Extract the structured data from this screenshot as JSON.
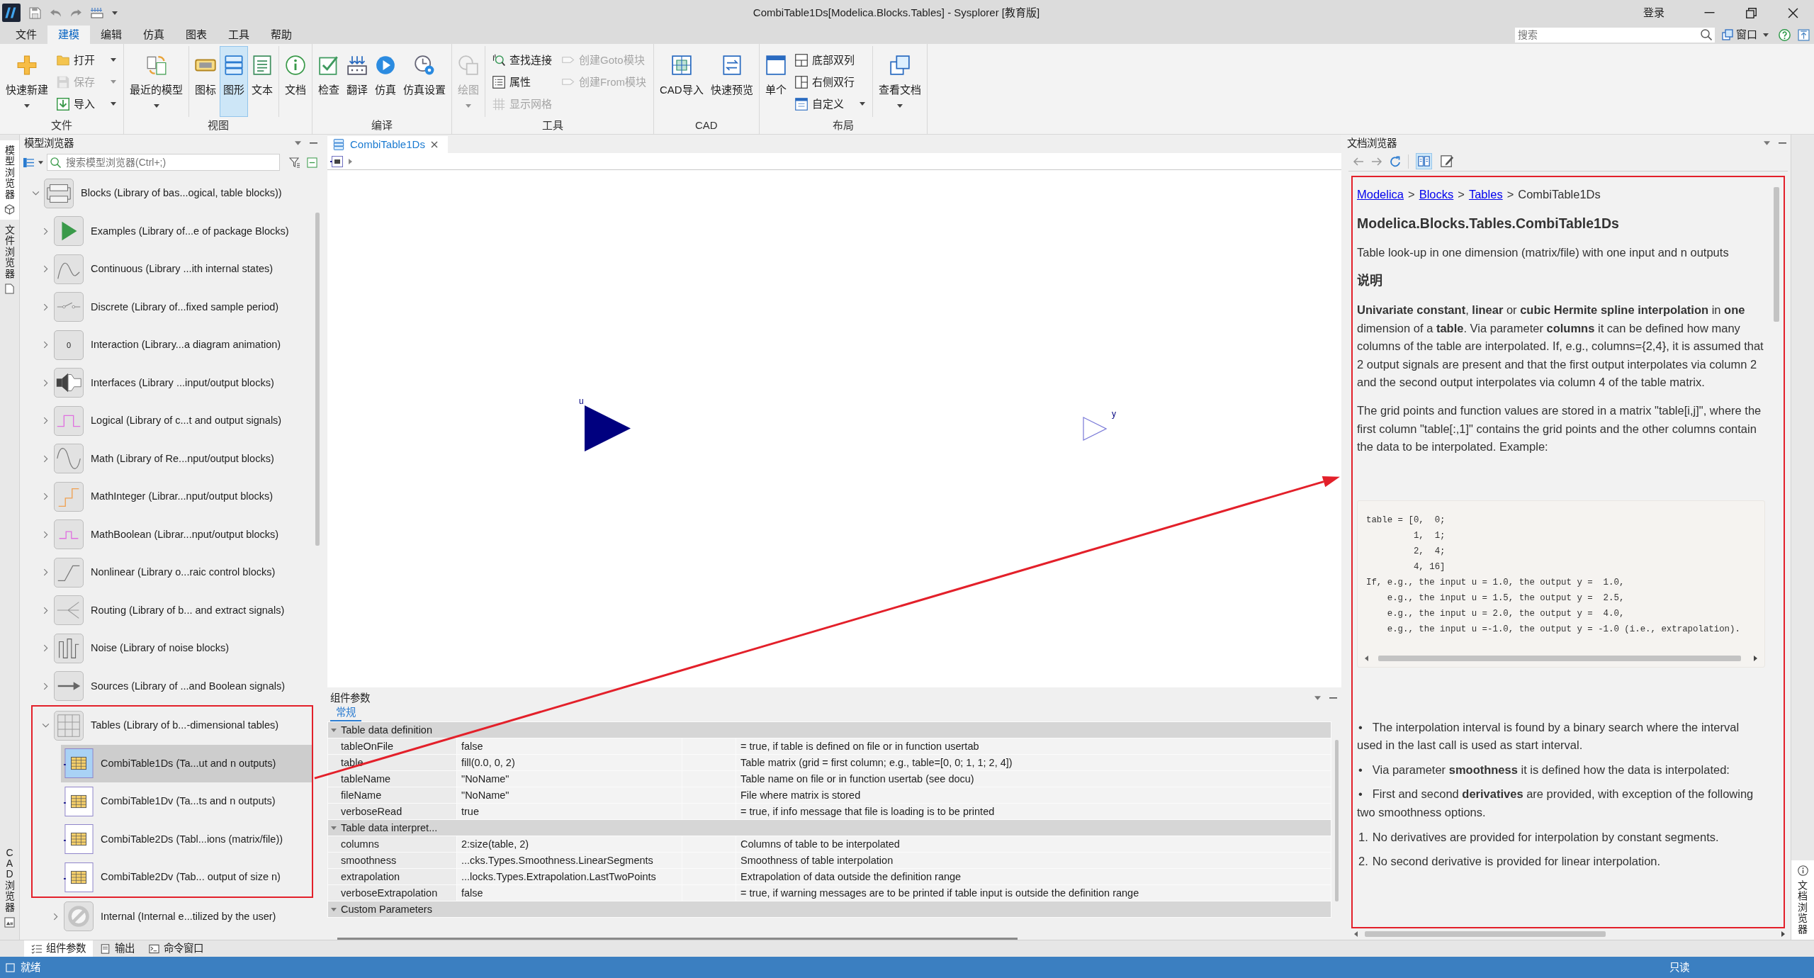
{
  "window": {
    "title": "CombiTable1Ds[Modelica.Blocks.Tables] - Sysplorer [教育版]",
    "login": "登录"
  },
  "menu": [
    {
      "label": "文件",
      "selected": false
    },
    {
      "label": "建模",
      "selected": true
    },
    {
      "label": "编辑",
      "selected": false
    },
    {
      "label": "仿真",
      "selected": false
    },
    {
      "label": "图表",
      "selected": false
    },
    {
      "label": "工具",
      "selected": false
    },
    {
      "label": "帮助",
      "selected": false
    }
  ],
  "search": {
    "placeholder": "搜索"
  },
  "window_menu": {
    "label": "窗口"
  },
  "ribbon": [
    {
      "label": "文件",
      "sections": [
        [
          {
            "label": "快速新建",
            "kind": "large",
            "dropdown": true,
            "disabled": false,
            "selected": false
          },
          {
            "label": "打开",
            "kind": "small",
            "dropdown": true,
            "disabled": false,
            "selected": false
          },
          {
            "label": "保存",
            "kind": "small",
            "dropdown": true,
            "disabled": true,
            "selected": false
          },
          {
            "label": "导入",
            "kind": "small",
            "dropdown": true,
            "disabled": false,
            "selected": false
          }
        ]
      ]
    },
    {
      "label": "视图",
      "sections": [
        [
          {
            "label": "最近的模型",
            "kind": "large",
            "dropdown": true,
            "disabled": false,
            "selected": false
          }
        ],
        [
          {
            "label": "图标",
            "kind": "large",
            "dropdown": false,
            "disabled": false,
            "selected": false
          },
          {
            "label": "图形",
            "kind": "large",
            "dropdown": false,
            "disabled": false,
            "selected": true
          },
          {
            "label": "文本",
            "kind": "large",
            "dropdown": false,
            "disabled": false,
            "selected": false
          }
        ],
        [
          {
            "label": "文档",
            "kind": "large",
            "dropdown": false,
            "disabled": false,
            "selected": false
          }
        ]
      ]
    },
    {
      "label": "编译",
      "sections": [
        [
          {
            "label": "检查",
            "kind": "large",
            "dropdown": false,
            "disabled": false,
            "selected": false
          },
          {
            "label": "翻译",
            "kind": "large",
            "dropdown": false,
            "disabled": false,
            "selected": false
          },
          {
            "label": "仿真",
            "kind": "large",
            "dropdown": false,
            "disabled": false,
            "selected": false
          },
          {
            "label": "仿真设置",
            "kind": "large",
            "dropdown": false,
            "disabled": false,
            "selected": false
          }
        ]
      ]
    },
    {
      "label": "工具",
      "sections": [
        [
          {
            "label": "绘图",
            "kind": "large",
            "dropdown": true,
            "disabled": true,
            "selected": false
          }
        ],
        [
          {
            "label": "查找连接",
            "kind": "small",
            "dropdown": false,
            "disabled": false,
            "selected": false
          },
          {
            "label": "属性",
            "kind": "small",
            "dropdown": false,
            "disabled": false,
            "selected": false
          },
          {
            "label": "显示网格",
            "kind": "small",
            "dropdown": false,
            "disabled": true,
            "selected": false
          },
          {
            "label": "创建Goto模块",
            "kind": "small",
            "dropdown": false,
            "disabled": true,
            "selected": false
          },
          {
            "label": "创建From模块",
            "kind": "small",
            "dropdown": false,
            "disabled": true,
            "selected": false
          }
        ]
      ]
    },
    {
      "label": "CAD",
      "sections": [
        [
          {
            "label": "CAD导入",
            "kind": "large",
            "dropdown": false,
            "disabled": false,
            "selected": false
          },
          {
            "label": "快速预览",
            "kind": "large",
            "dropdown": false,
            "disabled": false,
            "selected": false
          }
        ]
      ]
    },
    {
      "label": "布局",
      "sections": [
        [
          {
            "label": "单个",
            "kind": "large",
            "dropdown": false,
            "disabled": false,
            "selected": false
          },
          {
            "label": "底部双列",
            "kind": "small",
            "dropdown": false,
            "disabled": false,
            "selected": false
          },
          {
            "label": "右侧双行",
            "kind": "small",
            "dropdown": false,
            "disabled": false,
            "selected": false
          },
          {
            "label": "自定义",
            "kind": "small",
            "dropdown": true,
            "disabled": false,
            "selected": false
          }
        ],
        [
          {
            "label": "查看文档",
            "kind": "large",
            "dropdown": true,
            "disabled": false,
            "selected": false
          }
        ]
      ]
    }
  ],
  "left_tabs": [
    {
      "label": "模型浏览器",
      "selected": true
    },
    {
      "label": "文件浏览器",
      "selected": false
    },
    {
      "label": "CAD 浏览器",
      "selected": false
    }
  ],
  "model_browser": {
    "title": "模型浏览器",
    "search": {
      "placeholder": "搜索模型浏览器(Ctrl+;)"
    },
    "tree": [
      {
        "label": "Blocks (Library of bas...ogical, table blocks))",
        "kind": "package",
        "expanded": true,
        "selected": false,
        "children": [
          {
            "label": "Examples (Library of...e of package Blocks)",
            "kind": "package",
            "expanded": false,
            "selected": false
          },
          {
            "label": "Continuous (Library ...ith internal states)",
            "kind": "package",
            "expanded": false,
            "selected": false
          },
          {
            "label": "Discrete (Library of...fixed sample period)",
            "kind": "package",
            "expanded": false,
            "selected": false
          },
          {
            "label": "Interaction (Library...a diagram animation)",
            "kind": "package",
            "expanded": false,
            "selected": false,
            "icon_text": "0"
          },
          {
            "label": "Interfaces (Library ...input/output blocks)",
            "kind": "package",
            "expanded": false,
            "selected": false
          },
          {
            "label": "Logical (Library of c...t and output signals)",
            "kind": "package",
            "expanded": false,
            "selected": false
          },
          {
            "label": "Math (Library of Re...nput/output blocks)",
            "kind": "package",
            "expanded": false,
            "selected": false
          },
          {
            "label": "MathInteger (Librar...nput/output blocks)",
            "kind": "package",
            "expanded": false,
            "selected": false
          },
          {
            "label": "MathBoolean (Librar...nput/output blocks)",
            "kind": "package",
            "expanded": false,
            "selected": false
          },
          {
            "label": "Nonlinear (Library o...raic control blocks)",
            "kind": "package",
            "expanded": false,
            "selected": false
          },
          {
            "label": "Routing (Library of b... and extract signals)",
            "kind": "package",
            "expanded": false,
            "selected": false
          },
          {
            "label": "Noise (Library of noise blocks)",
            "kind": "package",
            "expanded": false,
            "selected": false
          },
          {
            "label": "Sources (Library of ...and Boolean signals)",
            "kind": "package",
            "expanded": false,
            "selected": false
          },
          {
            "label": "Tables (Library of b...-dimensional tables)",
            "kind": "package",
            "expanded": true,
            "selected": false,
            "children": [
              {
                "label": "CombiTable1Ds (Ta...ut and n outputs)",
                "kind": "model",
                "selected": true
              },
              {
                "label": "CombiTable1Dv (Ta...ts and n outputs)",
                "kind": "model",
                "selected": false
              },
              {
                "label": "CombiTable2Ds (Tabl...ions (matrix/file))",
                "kind": "model",
                "selected": false
              },
              {
                "label": "CombiTable2Dv (Tab... output of size n)",
                "kind": "model",
                "selected": false
              },
              {
                "label": "Internal (Internal e...tilized by the user)",
                "kind": "package",
                "expanded": false,
                "selected": false
              }
            ]
          }
        ]
      }
    ]
  },
  "editor": {
    "tabs": [
      {
        "label": "CombiTable1Ds",
        "selected": true
      }
    ],
    "connectors": [
      {
        "label": "u",
        "kind": "input"
      },
      {
        "label": "y",
        "kind": "output"
      }
    ]
  },
  "parameters": {
    "title": "组件参数",
    "tabs": [
      {
        "label": "常规",
        "selected": true
      }
    ],
    "groups": [
      {
        "title": "Table data definition",
        "expanded": true,
        "params": [
          {
            "name": "tableOnFile",
            "value": "false",
            "description": "= true, if table is defined on file or in function usertab"
          },
          {
            "name": "table",
            "value": "fill(0.0, 0, 2)",
            "description": "Table matrix (grid = first column; e.g., table=[0, 0; 1, 1; 2, 4])"
          },
          {
            "name": "tableName",
            "value": "\"NoName\"",
            "description": "Table name on file or in function usertab (see docu)"
          },
          {
            "name": "fileName",
            "value": "\"NoName\"",
            "description": "File where matrix is stored"
          },
          {
            "name": "verboseRead",
            "value": "true",
            "description": "= true, if info message that file is loading is to be printed"
          }
        ]
      },
      {
        "title": "Table data interpret...",
        "expanded": true,
        "params": [
          {
            "name": "columns",
            "value": "2:size(table, 2)",
            "description": "Columns of table to be interpolated"
          },
          {
            "name": "smoothness",
            "value": "...cks.Types.Smoothness.LinearSegments",
            "description": "Smoothness of table interpolation"
          },
          {
            "name": "extrapolation",
            "value": "...locks.Types.Extrapolation.LastTwoPoints",
            "description": "Extrapolation of data outside the definition range"
          },
          {
            "name": "verboseExtrapolation",
            "value": "false",
            "description": "= true, if warning messages are to be printed if table input is outside the definition range"
          }
        ]
      },
      {
        "title": "Custom Parameters",
        "expanded": true
      }
    ]
  },
  "doc_browser": {
    "title": "文档浏览器",
    "mode_buttons": [
      {
        "selected": true
      },
      {
        "selected": false
      }
    ],
    "breadcrumb": [
      {
        "kind": "link",
        "label": "Modelica"
      },
      {
        "kind": "separator",
        "label": ">"
      },
      {
        "kind": "link",
        "label": "Blocks"
      },
      {
        "kind": "separator",
        "label": ">"
      },
      {
        "kind": "link",
        "label": "Tables"
      },
      {
        "kind": "separator",
        "label": ">"
      },
      {
        "kind": "current",
        "label": "CombiTable1Ds"
      }
    ],
    "blocks": [
      {
        "kind": "title",
        "text": "Modelica.Blocks.Tables.CombiTable1Ds"
      },
      {
        "kind": "paragraph",
        "text": "Table look-up in one dimension (matrix/file) with one input and n outputs"
      },
      {
        "kind": "heading",
        "text": "说明"
      },
      {
        "kind": "paragraph",
        "text": "**Univariate constant**, **linear** or **cubic Hermite spline interpolation** in **one** dimension of a **table**. Via parameter **columns** it can be defined how many columns of the table are interpolated. If, e.g., columns={2,4}, it is assumed that 2 output signals are present and that the first output interpolates via column 2 and the second output interpolates via column 4 of the table matrix."
      },
      {
        "kind": "paragraph",
        "text": "The grid points and function values are stored in a matrix \"table[i,j]\", where the first column \"table[:,1]\" contains the grid points and the other columns contain the data to be interpolated. Example:"
      },
      {
        "kind": "code",
        "lines": [
          "table = [0,  0;",
          "         1,  1;",
          "         2,  4;",
          "         4, 16]",
          "If, e.g., the input u = 1.0, the output y =  1.0,",
          "    e.g., the input u = 1.5, the output y =  2.5,",
          "    e.g., the input u = 2.0, the output y =  4.0,",
          "    e.g., the input u =-1.0, the output y = -1.0 (i.e., extrapolation)."
        ]
      },
      {
        "kind": "bullet",
        "marker": "•",
        "text": "The interpolation interval is found by a binary search where the interval used in the last call is used as start interval."
      },
      {
        "kind": "bullet",
        "marker": "•",
        "text": "Via parameter **smoothness** it is defined how the data is interpolated:"
      },
      {
        "kind": "bullet",
        "marker": "•",
        "text": "First and second **derivatives** are provided, with exception of the following two smoothness options."
      },
      {
        "kind": "numbered",
        "marker": "1.",
        "text": "No derivatives are provided for interpolation by constant segments."
      },
      {
        "kind": "numbered",
        "marker": "2.",
        "text": "No second derivative is provided for linear interpolation."
      }
    ]
  },
  "right_tabs": [
    {
      "label": "文档浏览器",
      "selected": true
    }
  ],
  "bottom_tabs": [
    {
      "label": "组件参数",
      "selected": true
    },
    {
      "label": "输出",
      "selected": false
    },
    {
      "label": "命令窗口",
      "selected": false
    }
  ],
  "status_bar": {
    "status": "就绪",
    "access": "只读"
  },
  "annotations": {
    "tree_frame": true,
    "doc_frame": true,
    "arrow": true
  }
}
